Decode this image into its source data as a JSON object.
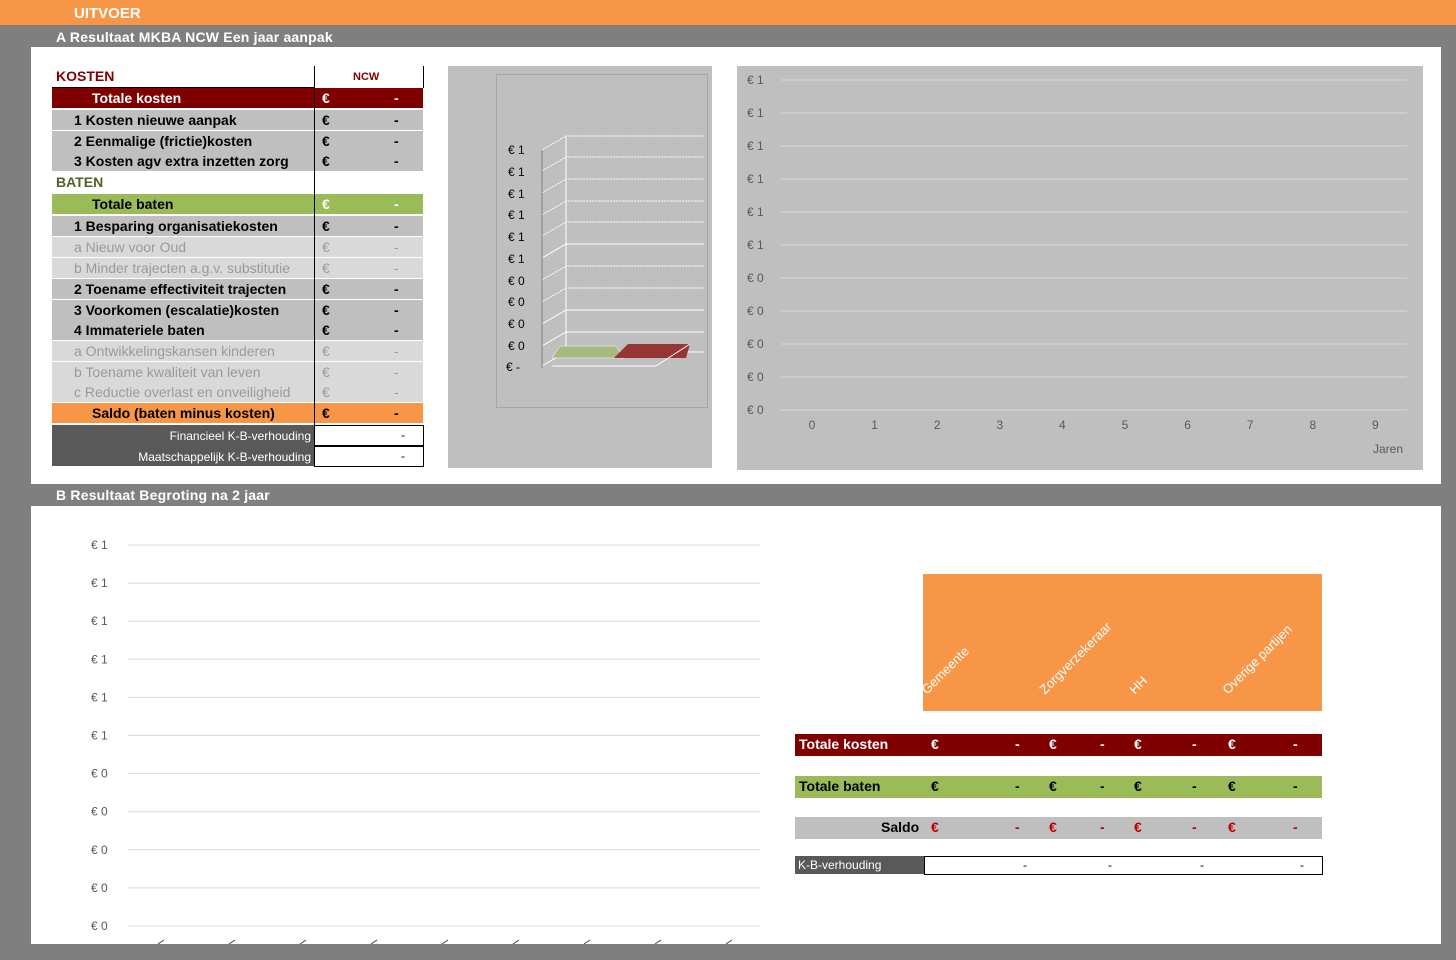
{
  "header": {
    "title": "UITVOER"
  },
  "sectionA": {
    "title": "A  Resultaat MKBA NCW Een jaar aanpak",
    "table": {
      "kosten_header": "KOSTEN",
      "ncw_header": "NCW",
      "baten_header": "BATEN",
      "rows": [
        {
          "label": "Totale kosten",
          "eur": "€",
          "value": "-"
        },
        {
          "label": "1  Kosten nieuwe aanpak",
          "eur": "€",
          "value": "-"
        },
        {
          "label": "2  Eenmalige (frictie)kosten",
          "eur": "€",
          "value": "-"
        },
        {
          "label": "3  Kosten agv extra inzetten zorg",
          "eur": "€",
          "value": "-"
        },
        {
          "label": "Totale baten",
          "eur": "€",
          "value": "-"
        },
        {
          "label": "1  Besparing organisatiekosten",
          "eur": "€",
          "value": "-"
        },
        {
          "label": "a  Nieuw voor Oud",
          "eur": "€",
          "value": "-"
        },
        {
          "label": "b  Minder trajecten a.g.v. substitutie",
          "eur": "€",
          "value": "-"
        },
        {
          "label": "2  Toename effectiviteit trajecten",
          "eur": "€",
          "value": "-"
        },
        {
          "label": "3  Voorkomen (escalatie)kosten",
          "eur": "€",
          "value": "-"
        },
        {
          "label": "4  Immateriele baten",
          "eur": "€",
          "value": "-"
        },
        {
          "label": "a  Ontwikkelingskansen kinderen",
          "eur": "€",
          "value": "-"
        },
        {
          "label": "b  Toename kwaliteit van leven",
          "eur": "€",
          "value": "-"
        },
        {
          "label": "c  Reductie overlast en onveiligheid",
          "eur": "€",
          "value": "-"
        },
        {
          "label": "Saldo (baten minus kosten)",
          "eur": "€",
          "value": "-"
        }
      ],
      "ratios": [
        {
          "label": "Financieel K-B-verhouding",
          "value": "-"
        },
        {
          "label": "Maatschappelijk K-B-verhouding",
          "value": "-"
        }
      ]
    },
    "chart3d": {
      "yticks": [
        "€ 1",
        "€ 1",
        "€ 1",
        "€ 1",
        "€ 1",
        "€ 1",
        "€ 0",
        "€ 0",
        "€ 0",
        "€ 0",
        "€ -"
      ]
    },
    "lineChart": {
      "yticks": [
        "€ 1",
        "€ 1",
        "€ 1",
        "€ 1",
        "€ 1",
        "€ 1",
        "€ 0",
        "€ 0",
        "€ 0",
        "€ 0",
        "€ 0"
      ],
      "xticks": [
        "0",
        "1",
        "2",
        "3",
        "4",
        "5",
        "6",
        "7",
        "8",
        "9"
      ],
      "xlabel": "Jaren"
    }
  },
  "sectionB": {
    "title": "B  Resultaat Begroting na 2 jaar",
    "chart": {
      "yticks": [
        "€ 1",
        "€ 1",
        "€ 1",
        "€ 1",
        "€ 1",
        "€ 1",
        "€ 0",
        "€ 0",
        "€ 0",
        "€ 0",
        "€ 0"
      ]
    },
    "table": {
      "columns": [
        "Gemeente",
        "Zorgverzekeraar",
        "HH",
        "Overige partijen"
      ],
      "rows": [
        {
          "label": "Totale kosten",
          "cells": [
            "€",
            "-",
            "€",
            "-",
            "€",
            "-",
            "€",
            "-"
          ]
        },
        {
          "label": "Totale baten",
          "cells": [
            "€",
            "-",
            "€",
            "-",
            "€",
            "-",
            "€",
            "-"
          ]
        },
        {
          "label": "Saldo",
          "cells": [
            "€",
            "-",
            "€",
            "-",
            "€",
            "-",
            "€",
            "-"
          ]
        }
      ],
      "ratio": {
        "label": "K-B-verhouding",
        "values": [
          "-",
          "-",
          "-",
          "-"
        ]
      }
    }
  },
  "colors": {
    "orange": "#f79646",
    "darkred": "#800000",
    "green": "#9bbb59",
    "grey": "#bfbfbf",
    "red": "#c00000"
  }
}
